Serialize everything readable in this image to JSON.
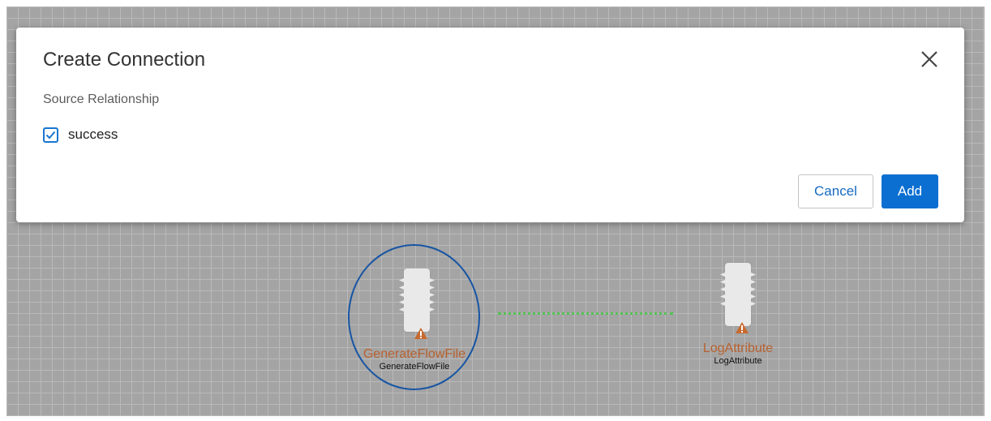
{
  "dialog": {
    "title": "Create Connection",
    "section_label": "Source Relationship",
    "relationships": [
      {
        "label": "success",
        "checked": true
      }
    ],
    "cancel_label": "Cancel",
    "add_label": "Add",
    "accent_color": "#0a6fd1"
  },
  "canvas": {
    "processors": [
      {
        "name": "GenerateFlowFile",
        "type": "GenerateFlowFile",
        "selected": true,
        "warning": true
      },
      {
        "name": "LogAttribute",
        "type": "LogAttribute",
        "selected": false,
        "warning": true
      }
    ],
    "connection": {
      "style": "dashed",
      "color": "#54c254"
    },
    "processor_name_color": "#b8612f",
    "selection_color": "#1855a3"
  }
}
